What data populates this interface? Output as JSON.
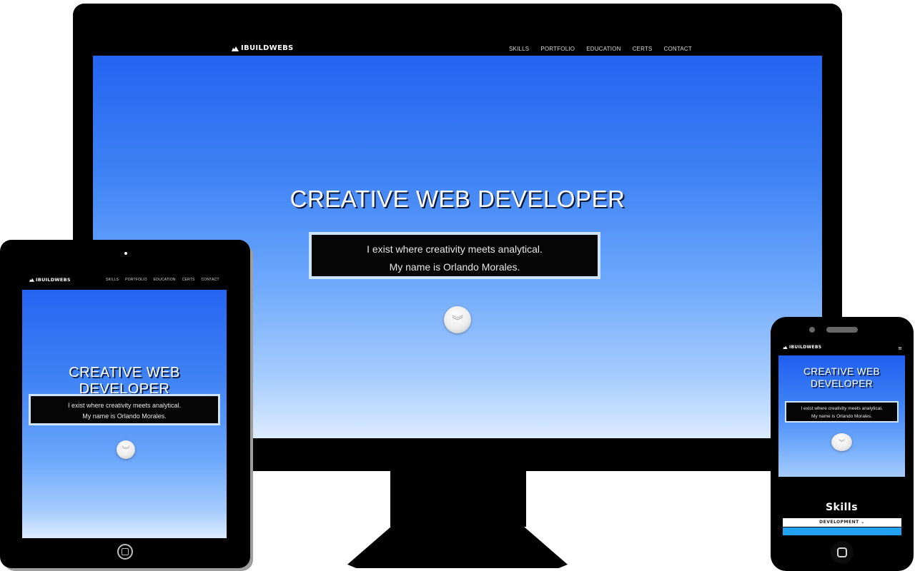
{
  "site": {
    "logo_text": "IBUILDWEBS",
    "nav": [
      "SKILLS",
      "PORTFOLIO",
      "EDUCATION",
      "CERTS",
      "CONTACT"
    ],
    "hero_title": "CREATIVE WEB DEVELOPER",
    "tagline_line1": "I exist where creativity meets analytical.",
    "tagline_line2": "My name is Orlando Morales.",
    "scroll_icon": "double-chevron-down-icon",
    "menu_icon": "hamburger-icon"
  },
  "mobile": {
    "skills_heading": "Skills",
    "development_label": "DEVELOPMENT ⌄"
  },
  "colors": {
    "sky_top": "#1f5ef0",
    "sky_bottom": "#dcebff",
    "box_border": "#cfe3fa",
    "accent_blue": "#22a2f2"
  }
}
